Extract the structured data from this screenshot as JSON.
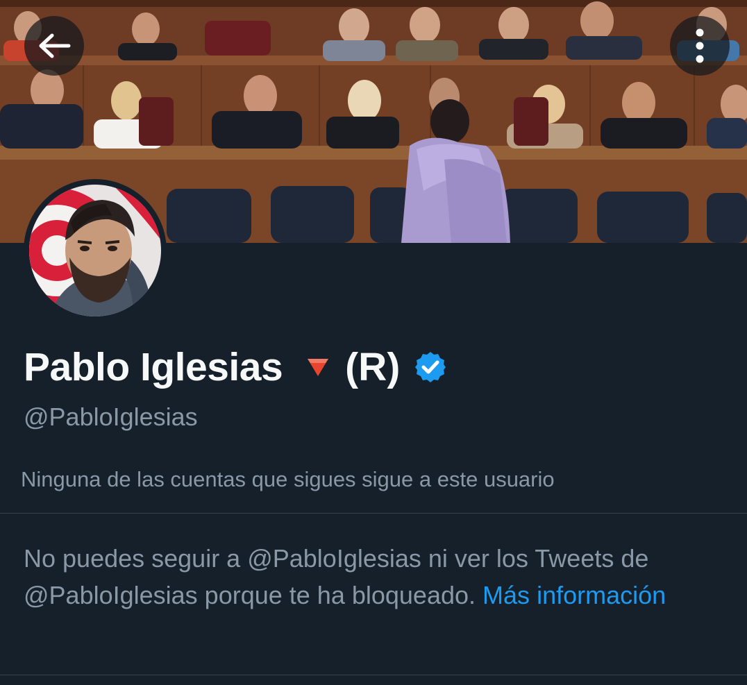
{
  "header": {
    "back_icon": "arrow-left-icon",
    "more_icon": "more-vertical-icon"
  },
  "banner": {
    "description_icon": "parliament-banner-image"
  },
  "profile": {
    "name": "Pablo Iglesias",
    "emoji_icon": "red-triangle-down-icon",
    "suffix": "(R)",
    "verified_icon": "verified-badge-icon",
    "verified_color": "#1d9bf0",
    "handle": "@PabloIglesias",
    "followers_note": "Ninguna de las cuentas que sigues sigue a este usuario"
  },
  "blocked": {
    "message_part1": "No puedes seguir a @PabloIglesias ni ver los Tweets de @PabloIglesias porque te ha bloqueado.",
    "link_text_1": "Más",
    "link_text_2": "información"
  },
  "colors": {
    "background": "#15202b",
    "primary_text": "#f7f9f9",
    "secondary_text": "#8b98a5",
    "link": "#1d9bf0",
    "divider": "#38444d"
  }
}
